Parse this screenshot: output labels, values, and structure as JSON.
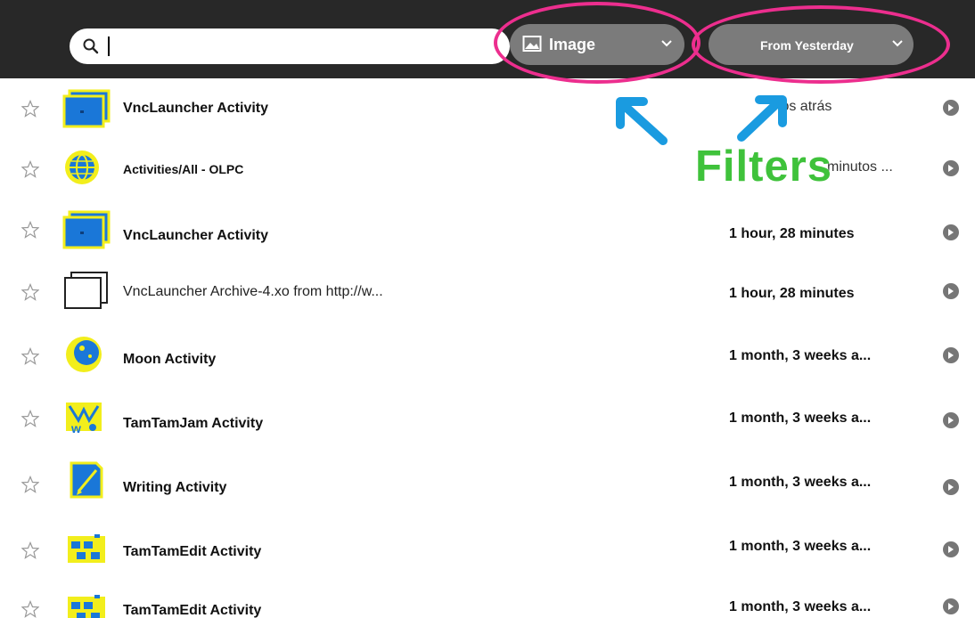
{
  "toolbar": {
    "search": {
      "value": "",
      "icon": "search-icon"
    },
    "type_filter": {
      "label": "Image",
      "icon": "image-icon"
    },
    "date_filter": {
      "label": "From Yesterday"
    }
  },
  "annotation": {
    "label": "Filters",
    "colors": {
      "oval": "#ec2e8e",
      "arrow": "#1a9be0",
      "label": "#3fc23b"
    }
  },
  "rows": [
    {
      "title": "VncLauncher Activity",
      "time": "",
      "icon": "vnclauncher-icon",
      "starred": false
    },
    {
      "title": "Activities/All - OLPC",
      "time": "",
      "icon": "browse-globe-icon",
      "starred": false
    },
    {
      "title": "VncLauncher Activity",
      "time": "1 hour, 28 minutes",
      "icon": "vnclauncher-icon",
      "starred": false
    },
    {
      "title": "VncLauncher Archive-4.xo from http://w...",
      "time": "1 hour, 28 minutes",
      "icon": "file-archive-icon",
      "starred": false
    },
    {
      "title": "Moon Activity",
      "time": "1 month, 3 weeks a...",
      "icon": "moon-icon",
      "starred": false
    },
    {
      "title": "TamTamJam Activity",
      "time": "1 month, 3 weeks a...",
      "icon": "tamtamjam-icon",
      "starred": false
    },
    {
      "title": "Writing Activity",
      "time": "1 month, 3 weeks a...",
      "icon": "write-icon",
      "starred": false
    },
    {
      "title": "TamTamEdit Activity",
      "time": "1 month, 3 weeks a...",
      "icon": "tamtamedit-icon",
      "starred": false
    },
    {
      "title": "TamTamEdit Activity",
      "time": "1 month, 3 weeks a...",
      "icon": "tamtamedit-icon",
      "starred": false
    }
  ],
  "partial_time_fragments": {
    "row0": "tos atrás",
    "row1": "minutos ..."
  }
}
